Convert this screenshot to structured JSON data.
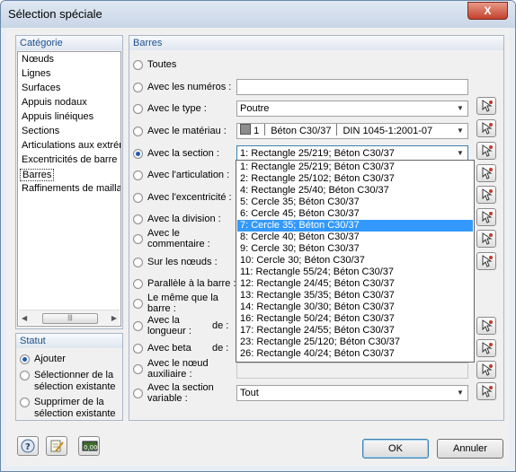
{
  "window": {
    "title": "Sélection spéciale",
    "close_glyph": "X"
  },
  "categorie": {
    "header": "Catégorie",
    "items": [
      "Nœuds",
      "Lignes",
      "Surfaces",
      "Appuis nodaux",
      "Appuis linéiques",
      "Sections",
      "Articulations aux extrém",
      "Excentricités de barre",
      "Barres",
      "Raffinements de maillag"
    ],
    "selected": "Barres"
  },
  "statut": {
    "header": "Statut",
    "options": [
      "Ajouter",
      "Sélectionner de la sélection existante",
      "Supprimer de la sélection existante"
    ],
    "lines": [
      [
        "Ajouter"
      ],
      [
        "Sélectionner de la",
        "sélection existante"
      ],
      [
        "Supprimer de la",
        "sélection existante"
      ]
    ],
    "selected": "Ajouter"
  },
  "barres": {
    "header": "Barres",
    "rows": {
      "toutes": "Toutes",
      "numeros": "Avec les numéros :",
      "type": "Avec le type :",
      "materiau": "Avec le matériau :",
      "section": "Avec la section :",
      "articulation": "Avec l'articulation :",
      "excentricite": "Avec l'excentricité :",
      "division": "Avec la division :",
      "commentaire": [
        "Avec le",
        "commentaire :"
      ],
      "noeuds": "Sur les nœuds :",
      "parallele": "Parallèle à la barre :",
      "meme": [
        "Le même que la",
        "barre :"
      ],
      "longueur": [
        "Avec la",
        "longueur :"
      ],
      "longueur_de": "de :",
      "beta": "Avec beta",
      "beta_de": "de :",
      "noeud_aux": [
        "Avec le nœud",
        "auxiliaire :"
      ],
      "section_var": [
        "Avec la section",
        "variable :"
      ]
    },
    "selected_radio": "section",
    "values": {
      "numeros": "",
      "type": "Poutre",
      "materiau_num": "1",
      "materiau_name": "Béton C30/37",
      "materiau_norm": "DIN 1045-1:2001-07",
      "section": "1: Rectangle 25/219; Béton C30/37",
      "section_var": "Tout"
    },
    "section_options": [
      "1: Rectangle 25/219; Béton C30/37",
      "2: Rectangle 25/102; Béton C30/37",
      "4: Rectangle 25/40; Béton C30/37",
      "5: Cercle 35; Béton C30/37",
      "6: Cercle 45; Béton C30/37",
      "7: Cercle 35; Béton C30/37",
      "8: Cercle 40; Béton C30/37",
      "9: Cercle 30; Béton C30/37",
      "10: Cercle 30; Béton C30/37",
      "11: Rectangle 55/24; Béton C30/37",
      "12: Rectangle 24/45; Béton C30/37",
      "13: Rectangle 35/35; Béton C30/37",
      "14: Rectangle 30/30; Béton C30/37",
      "16: Rectangle 50/24; Béton C30/37",
      "17: Rectangle 24/55; Béton C30/37",
      "23: Rectangle 25/120; Béton C30/37",
      "26: Rectangle 40/24; Béton C30/37"
    ],
    "highlighted_option": "7: Cercle 35; Béton C30/37"
  },
  "footer": {
    "ok_label": "OK",
    "cancel_label": "Annuler",
    "tool_icons": [
      "help-icon",
      "edit-notes-icon",
      "units-icon"
    ],
    "units_icon_text": "0,00"
  },
  "icons": {
    "pick": "select-in-graphic-icon",
    "dropdown": "chevron-down-icon"
  }
}
